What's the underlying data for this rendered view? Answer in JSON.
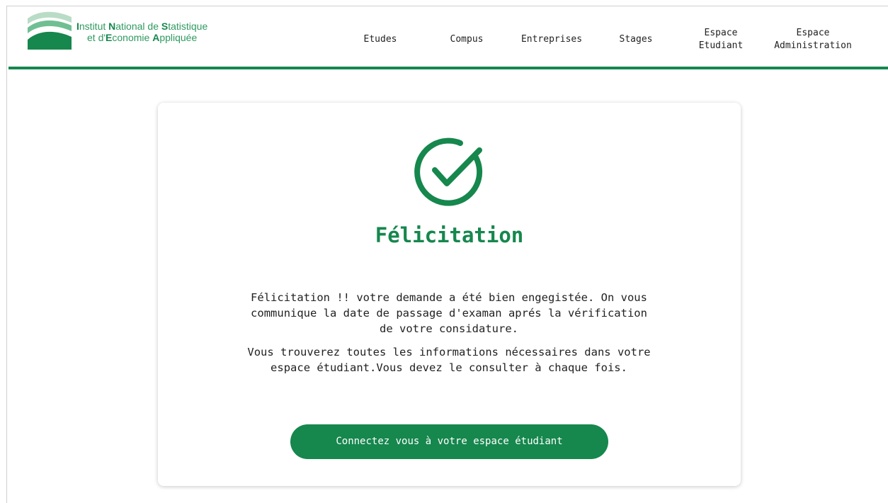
{
  "logo": {
    "name": "INSEA logo",
    "line1": [
      {
        "text": "I",
        "hl": true
      },
      {
        "text": "nstitut ",
        "hl": false
      },
      {
        "text": "N",
        "hl": true
      },
      {
        "text": "ational de ",
        "hl": false
      },
      {
        "text": "S",
        "hl": true
      },
      {
        "text": "tatistique",
        "hl": false
      }
    ],
    "line2": [
      {
        "text": "et d'",
        "hl": false
      },
      {
        "text": "E",
        "hl": true
      },
      {
        "text": "conomie ",
        "hl": false
      },
      {
        "text": "A",
        "hl": true
      },
      {
        "text": "ppliquée",
        "hl": false
      }
    ]
  },
  "nav": {
    "etudes": "Etudes",
    "compus": "Compus",
    "entreprises": "Entreprises",
    "stages": "Stages",
    "espace_etudiant_1": "Espace",
    "espace_etudiant_2": "Etudiant",
    "espace_admin_1": "Espace",
    "espace_admin_2": "Administration"
  },
  "card": {
    "icon": "check-circle-icon",
    "title": "Félicitation",
    "message1": "Félicitation !! votre demande a été bien engegistée. On vous communique la date de passage d'examan aprés la vérification de votre considature.",
    "message2": "Vous trouverez toutes les informations nécessaires dans votre espace étudiant.Vous devez le consulter à chaque fois.",
    "button_label": "Connectez vous à votre espace étudiant"
  },
  "colors": {
    "accent": "#16874d",
    "logo_light": "#b9dcc6",
    "logo_mid": "#6fbf93",
    "text": "#222222"
  }
}
